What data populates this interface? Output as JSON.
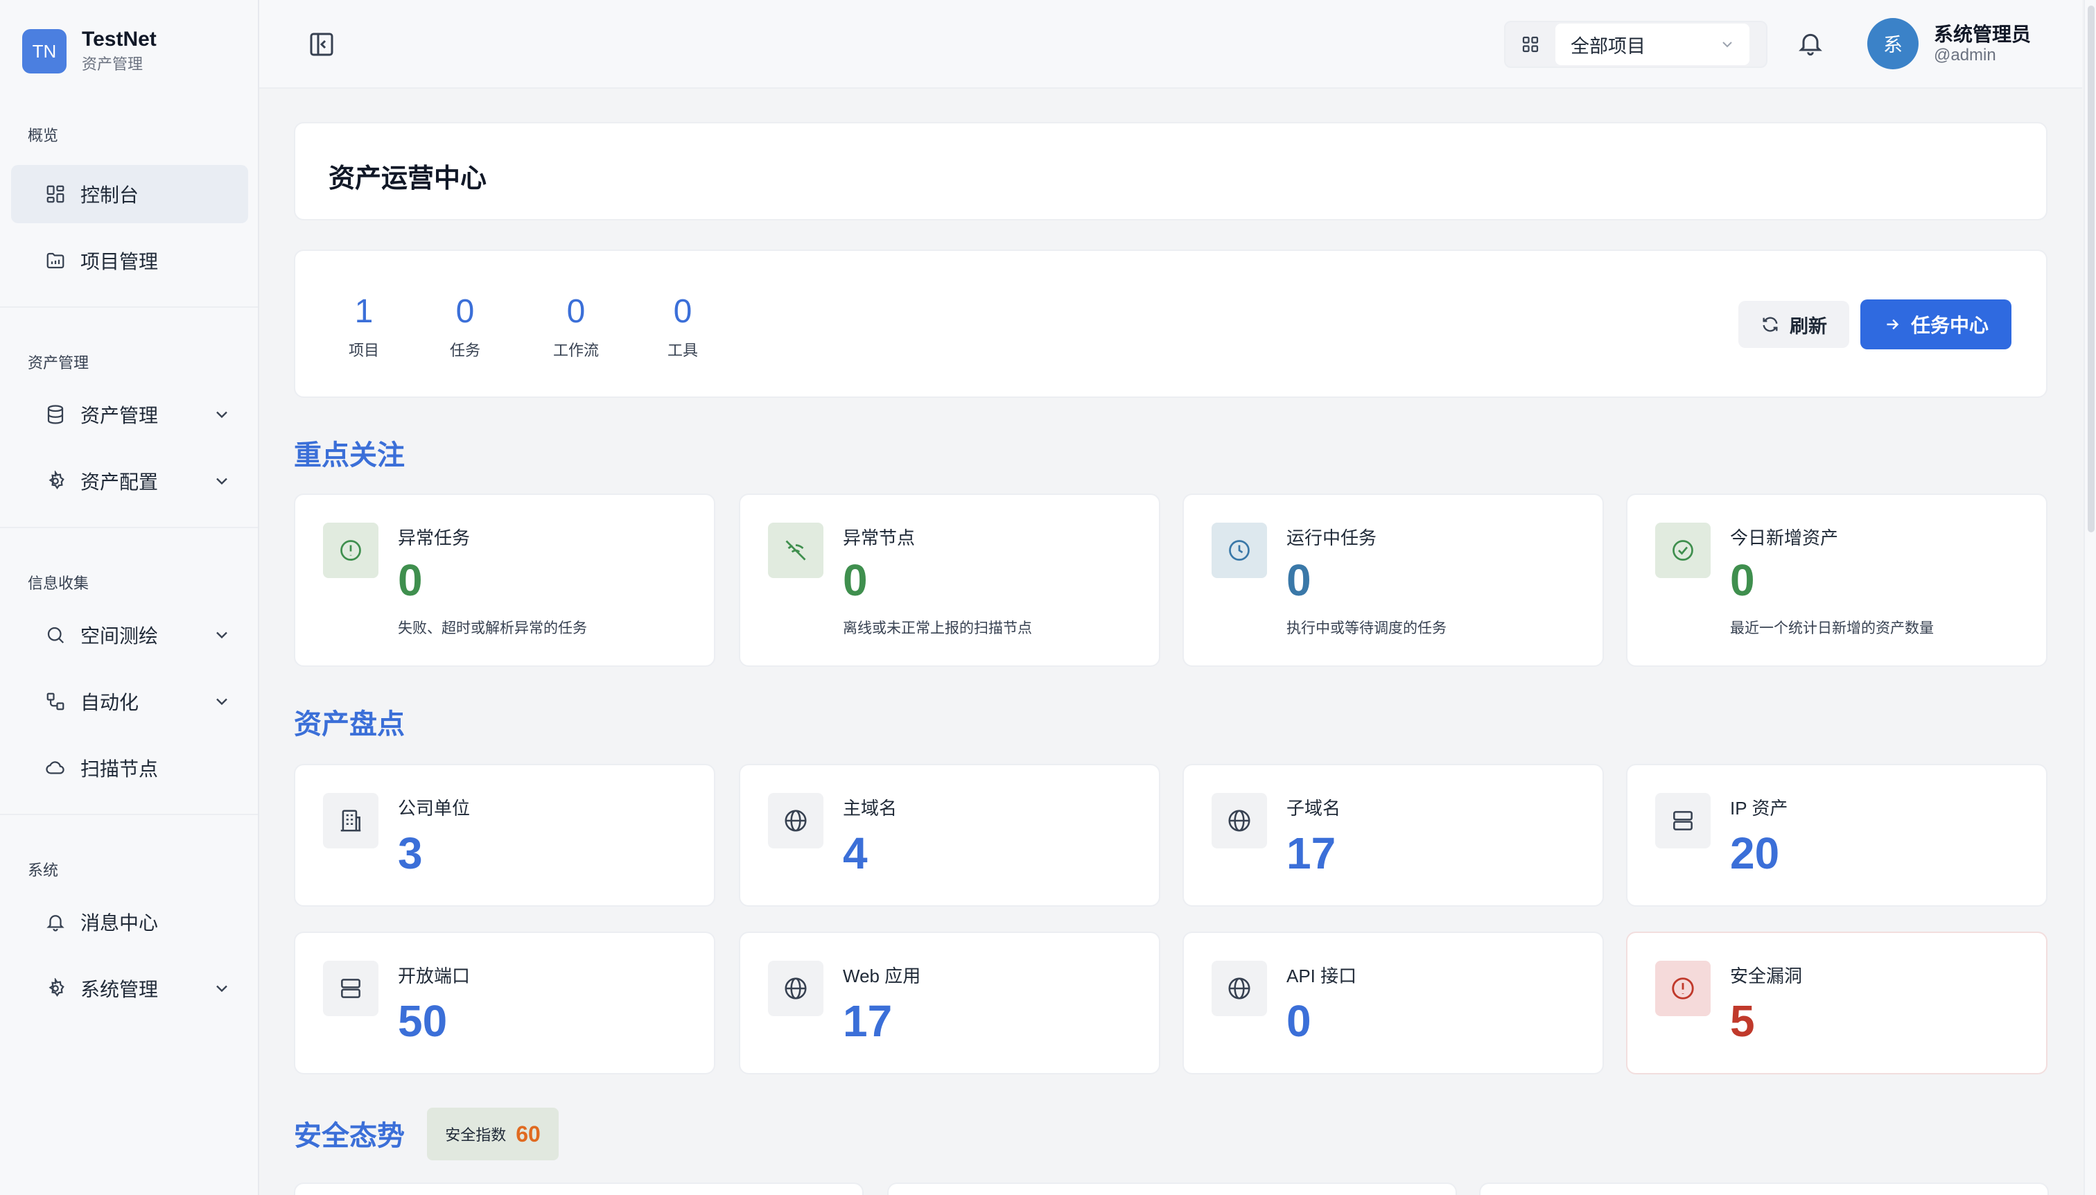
{
  "brand": {
    "logo": "TN",
    "name": "TestNet",
    "subtitle": "资产管理"
  },
  "sidebar": {
    "groups": [
      {
        "label": "概览"
      },
      {
        "label": "资产管理"
      },
      {
        "label": "信息收集"
      },
      {
        "label": "系统"
      }
    ],
    "items": [
      {
        "label": "控制台",
        "icon": "dashboard-icon",
        "active": true
      },
      {
        "label": "项目管理",
        "icon": "folder-icon"
      },
      {
        "label": "资产管理",
        "icon": "database-icon",
        "expandable": true
      },
      {
        "label": "资产配置",
        "icon": "gear-icon",
        "expandable": true
      },
      {
        "label": "空间测绘",
        "icon": "search-icon",
        "expandable": true
      },
      {
        "label": "自动化",
        "icon": "workflow-icon",
        "expandable": true
      },
      {
        "label": "扫描节点",
        "icon": "cloud-icon"
      },
      {
        "label": "消息中心",
        "icon": "bell-icon"
      },
      {
        "label": "系统管理",
        "icon": "gear-icon",
        "expandable": true
      }
    ]
  },
  "topbar": {
    "project_select": {
      "value": "全部项目"
    },
    "user": {
      "avatar": "系",
      "name": "系统管理员",
      "handle": "@admin"
    }
  },
  "header": {
    "title": "资产运营中心"
  },
  "summary": {
    "stats": [
      {
        "value": "1",
        "label": "项目"
      },
      {
        "value": "0",
        "label": "任务"
      },
      {
        "value": "0",
        "label": "工作流"
      },
      {
        "value": "0",
        "label": "工具"
      }
    ],
    "refresh_label": "刷新",
    "task_center_label": "任务中心"
  },
  "focus": {
    "title": "重点关注",
    "tiles": [
      {
        "label": "异常任务",
        "value": "0",
        "desc": "失败、超时或解析异常的任务",
        "icon": "alert-icon"
      },
      {
        "label": "异常节点",
        "value": "0",
        "desc": "离线或未正常上报的扫描节点",
        "icon": "wifi-off-icon"
      },
      {
        "label": "运行中任务",
        "value": "0",
        "desc": "执行中或等待调度的任务",
        "icon": "clock-icon"
      },
      {
        "label": "今日新增资产",
        "value": "0",
        "desc": "最近一个统计日新增的资产数量",
        "icon": "check-circle-icon"
      }
    ]
  },
  "inventory": {
    "title": "资产盘点",
    "tiles": [
      {
        "label": "公司单位",
        "value": "3",
        "icon": "building-icon"
      },
      {
        "label": "主域名",
        "value": "4",
        "icon": "globe-icon"
      },
      {
        "label": "子域名",
        "value": "17",
        "icon": "globe-icon"
      },
      {
        "label": "IP 资产",
        "value": "20",
        "icon": "server-icon"
      },
      {
        "label": "开放端口",
        "value": "50",
        "icon": "server-icon"
      },
      {
        "label": "Web 应用",
        "value": "17",
        "icon": "globe-icon"
      },
      {
        "label": "API 接口",
        "value": "0",
        "icon": "globe-icon"
      },
      {
        "label": "安全漏洞",
        "value": "5",
        "icon": "alert-icon"
      }
    ]
  },
  "security": {
    "title": "安全态势",
    "score_label": "安全指数",
    "score_value": "60"
  },
  "colors": {
    "accent": "#3b6fd8",
    "primary_button": "#2f6ae0",
    "ok_green": "#3f8f4e",
    "danger_red": "#c0392b",
    "score_orange": "#e06a20"
  }
}
